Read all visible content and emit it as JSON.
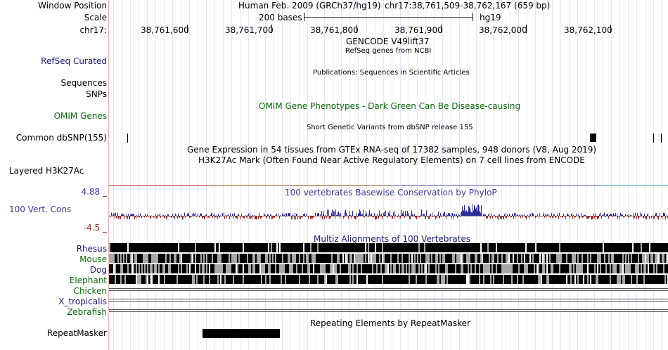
{
  "labels": {
    "window_position": "Window Position",
    "scale": "Scale",
    "chr": "chr17:",
    "refseq_curated": "RefSeq Curated",
    "sequences": "Sequences",
    "snps": "SNPs",
    "omim_genes": "OMIM Genes",
    "common_dbsnp": "Common dbSNP(155)",
    "layered_h3k27ac": "Layered H3K27Ac",
    "cons_max": "4.88 _",
    "vert_cons": "100 Vert. Cons",
    "cons_min": "-4.5 _",
    "rhesus": "Rhesus",
    "mouse": "Mouse",
    "dog": "Dog",
    "elephant": "Elephant",
    "chicken": "Chicken",
    "x_tropicalis": "X_tropicalis",
    "zebrafish": "Zebrafish",
    "repeatmasker": "RepeatMasker"
  },
  "header": {
    "assembly": "Human Feb. 2009 (GRCh37/hg19)",
    "position": "chr17:38,761,509-38,762,167 (659 bp)",
    "scale_text": "200 bases",
    "db": "hg19",
    "ticks": [
      "38,761,600",
      "38,761,700",
      "38,761,800",
      "38,761,900",
      "38,762,000",
      "38,762,100"
    ]
  },
  "tracks": {
    "gencode_title": "GENCODE V49lift37",
    "refseq_title": "RefSeq genes from NCBI",
    "publications_title": "Publications: Sequences in Scientific Articles",
    "omim_title": "OMIM Gene Phenotypes - Dark Green Can Be Disease-causing",
    "dbsnp_title": "Short Genetic Variants from dbSNP release 155",
    "gtex_title": "Gene Expression in 54 tissues from GTEx RNA-seq of 17382 samples, 948 donors (V8, Aug 2019)",
    "h3k27ac_title": "H3K27Ac Mark (Often Found Near Active Regulatory Elements) on 7 cell lines from ENCODE",
    "phylop_title": "100 vertebrates Basewise Conservation by PhyloP",
    "multiz_title": "Multiz Alignments of 100 Vertebrates",
    "repeatmasker_title": "Repeating Elements by RepeatMasker"
  },
  "colors": {
    "label_blue": "#1a1a7a",
    "label_green": "#0a6a0a",
    "phylop_title": "#3b3ba0",
    "phylop_pos": "#2b2b9a",
    "phylop_neg": "#9a2b2b",
    "cons_max": "#3b3ba0",
    "cons_min": "#9a2b2b"
  }
}
